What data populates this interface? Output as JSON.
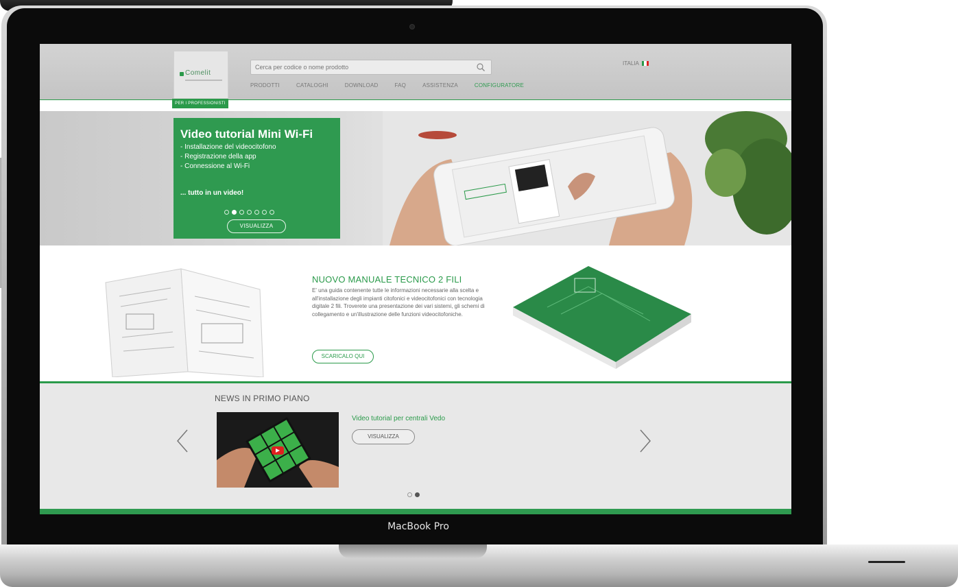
{
  "device": {
    "label": "MacBook Pro"
  },
  "header": {
    "logo_text": "Comelit",
    "search_placeholder": "Cerca per codice o nome prodotto",
    "nav": [
      "PRODOTTI",
      "CATALOGHI",
      "DOWNLOAD",
      "FAQ",
      "ASSISTENZA",
      "CONFIGURATORE"
    ],
    "nav_active_index": 5,
    "language": "ITALIA",
    "pro_tab": "PER I PROFESSIONISTI"
  },
  "hero": {
    "title": "Video tutorial Mini Wi-Fi",
    "bullets": [
      "- Installazione del videocitofono",
      "- Registrazione della app",
      "- Connessione al Wi-Fi"
    ],
    "cta_text": "... tutto in un video!",
    "slide_count": 7,
    "active_slide": 2,
    "button_label": "VISUALIZZA"
  },
  "manual": {
    "title": "NUOVO MANUALE TECNICO 2 FILI",
    "text": "E' una guida contenente tutte le informazioni necessarie alla scelta e all'installazione degli impianti citofonici e videocitofonici con tecnologia digitale 2 fili. Troverete una presentazione dei vari sistemi, gli schemi di collegamento e un'illustrazione delle funzioni videocitofoniche.",
    "button_label": "SCARICALO QUI"
  },
  "news": {
    "title": "NEWS IN PRIMO PIANO",
    "item_title": "Video tutorial per centrali Vedo",
    "button_label": "VISUALIZZA",
    "page_count": 2,
    "active_page": 2
  },
  "colors": {
    "brand_green": "#2a9a4a",
    "header_grey": "#c8c8c8",
    "news_bg": "#e8e8e8"
  }
}
